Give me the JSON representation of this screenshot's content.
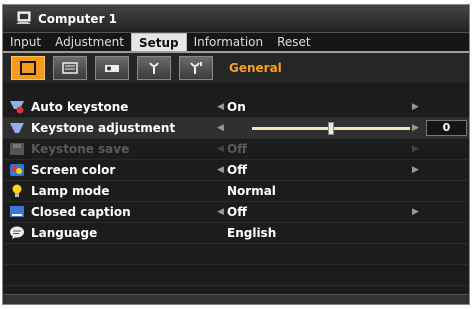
{
  "window": {
    "title": "Computer 1"
  },
  "menu": [
    {
      "label": "Input",
      "active": false
    },
    {
      "label": "Adjustment",
      "active": false
    },
    {
      "label": "Setup",
      "active": true
    },
    {
      "label": "Information",
      "active": false
    },
    {
      "label": "Reset",
      "active": false
    }
  ],
  "tabs": {
    "group_label": "General",
    "icons": [
      "general-tab-icon",
      "menu-tab-icon",
      "installation-tab-icon",
      "options-1-tab-icon",
      "options-2-tab-icon"
    ]
  },
  "settings": [
    {
      "label": "Auto keystone",
      "value": "On",
      "icon": "auto-keystone-icon"
    },
    {
      "label": "Keystone adjustment",
      "value": "0",
      "icon": "keystone-adjustment-icon"
    },
    {
      "label": "Keystone save",
      "value": "Off",
      "icon": "keystone-save-icon"
    },
    {
      "label": "Screen color",
      "value": "Off",
      "icon": "screen-color-icon"
    },
    {
      "label": "Lamp mode",
      "value": "Normal",
      "icon": "lamp-icon"
    },
    {
      "label": "Closed caption",
      "value": "Off",
      "icon": "closed-caption-icon"
    },
    {
      "label": "Language",
      "value": "English",
      "icon": "language-icon"
    }
  ],
  "keystone_slider": {
    "fraction": 0.5
  },
  "colors": {
    "accent": "#f59a1a",
    "background": "#1c1c1c",
    "disabled": "#5a5a5a"
  }
}
